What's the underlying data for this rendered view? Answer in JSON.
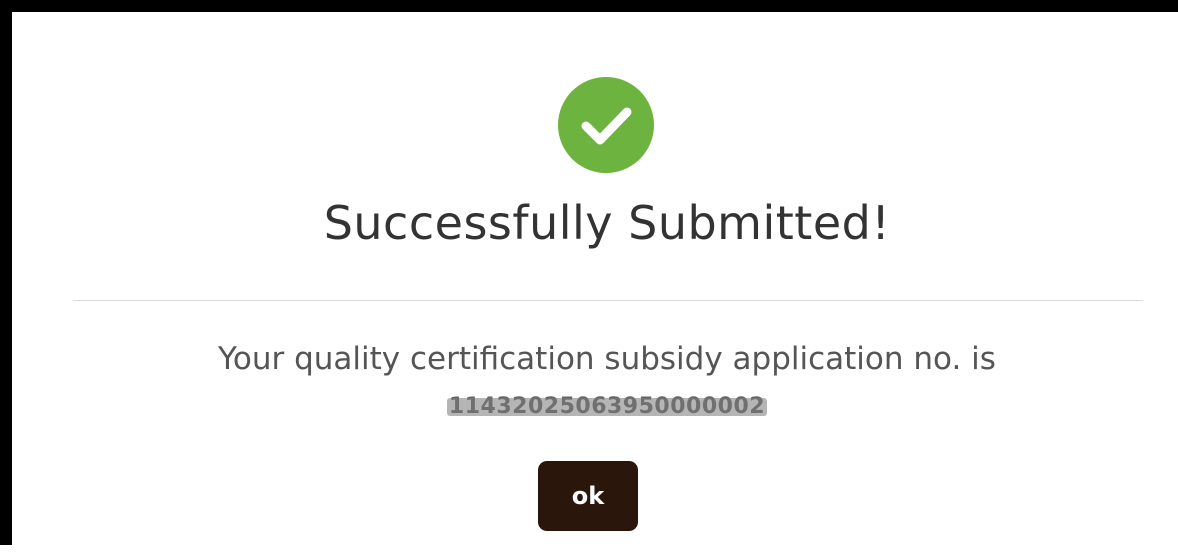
{
  "dialog": {
    "title": "Successfully Submitted!",
    "message": "Your quality certification subsidy application no. is",
    "application_number": "11432025063950000002",
    "ok_label": "ok"
  },
  "colors": {
    "success_green": "#6db33f",
    "button_bg": "#2a160a",
    "title_text": "#333333",
    "message_text": "#555555"
  },
  "icons": {
    "status": "check-circle-icon"
  }
}
